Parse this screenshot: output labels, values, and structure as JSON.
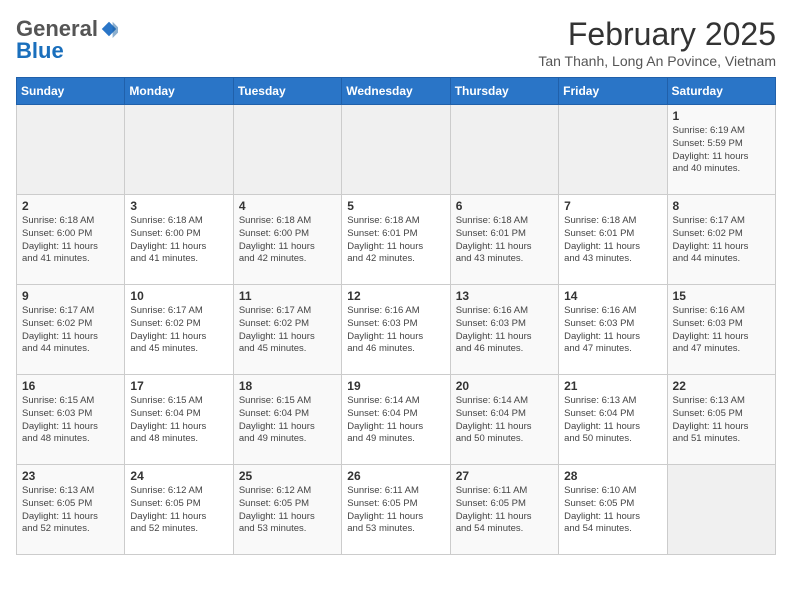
{
  "logo": {
    "general": "General",
    "blue": "Blue"
  },
  "title": "February 2025",
  "subtitle": "Tan Thanh, Long An Povince, Vietnam",
  "days_header": [
    "Sunday",
    "Monday",
    "Tuesday",
    "Wednesday",
    "Thursday",
    "Friday",
    "Saturday"
  ],
  "weeks": [
    [
      {
        "day": "",
        "info": ""
      },
      {
        "day": "",
        "info": ""
      },
      {
        "day": "",
        "info": ""
      },
      {
        "day": "",
        "info": ""
      },
      {
        "day": "",
        "info": ""
      },
      {
        "day": "",
        "info": ""
      },
      {
        "day": "1",
        "info": "Sunrise: 6:19 AM\nSunset: 5:59 PM\nDaylight: 11 hours\nand 40 minutes."
      }
    ],
    [
      {
        "day": "2",
        "info": "Sunrise: 6:18 AM\nSunset: 6:00 PM\nDaylight: 11 hours\nand 41 minutes."
      },
      {
        "day": "3",
        "info": "Sunrise: 6:18 AM\nSunset: 6:00 PM\nDaylight: 11 hours\nand 41 minutes."
      },
      {
        "day": "4",
        "info": "Sunrise: 6:18 AM\nSunset: 6:00 PM\nDaylight: 11 hours\nand 42 minutes."
      },
      {
        "day": "5",
        "info": "Sunrise: 6:18 AM\nSunset: 6:01 PM\nDaylight: 11 hours\nand 42 minutes."
      },
      {
        "day": "6",
        "info": "Sunrise: 6:18 AM\nSunset: 6:01 PM\nDaylight: 11 hours\nand 43 minutes."
      },
      {
        "day": "7",
        "info": "Sunrise: 6:18 AM\nSunset: 6:01 PM\nDaylight: 11 hours\nand 43 minutes."
      },
      {
        "day": "8",
        "info": "Sunrise: 6:17 AM\nSunset: 6:02 PM\nDaylight: 11 hours\nand 44 minutes."
      }
    ],
    [
      {
        "day": "9",
        "info": "Sunrise: 6:17 AM\nSunset: 6:02 PM\nDaylight: 11 hours\nand 44 minutes."
      },
      {
        "day": "10",
        "info": "Sunrise: 6:17 AM\nSunset: 6:02 PM\nDaylight: 11 hours\nand 45 minutes."
      },
      {
        "day": "11",
        "info": "Sunrise: 6:17 AM\nSunset: 6:02 PM\nDaylight: 11 hours\nand 45 minutes."
      },
      {
        "day": "12",
        "info": "Sunrise: 6:16 AM\nSunset: 6:03 PM\nDaylight: 11 hours\nand 46 minutes."
      },
      {
        "day": "13",
        "info": "Sunrise: 6:16 AM\nSunset: 6:03 PM\nDaylight: 11 hours\nand 46 minutes."
      },
      {
        "day": "14",
        "info": "Sunrise: 6:16 AM\nSunset: 6:03 PM\nDaylight: 11 hours\nand 47 minutes."
      },
      {
        "day": "15",
        "info": "Sunrise: 6:16 AM\nSunset: 6:03 PM\nDaylight: 11 hours\nand 47 minutes."
      }
    ],
    [
      {
        "day": "16",
        "info": "Sunrise: 6:15 AM\nSunset: 6:03 PM\nDaylight: 11 hours\nand 48 minutes."
      },
      {
        "day": "17",
        "info": "Sunrise: 6:15 AM\nSunset: 6:04 PM\nDaylight: 11 hours\nand 48 minutes."
      },
      {
        "day": "18",
        "info": "Sunrise: 6:15 AM\nSunset: 6:04 PM\nDaylight: 11 hours\nand 49 minutes."
      },
      {
        "day": "19",
        "info": "Sunrise: 6:14 AM\nSunset: 6:04 PM\nDaylight: 11 hours\nand 49 minutes."
      },
      {
        "day": "20",
        "info": "Sunrise: 6:14 AM\nSunset: 6:04 PM\nDaylight: 11 hours\nand 50 minutes."
      },
      {
        "day": "21",
        "info": "Sunrise: 6:13 AM\nSunset: 6:04 PM\nDaylight: 11 hours\nand 50 minutes."
      },
      {
        "day": "22",
        "info": "Sunrise: 6:13 AM\nSunset: 6:05 PM\nDaylight: 11 hours\nand 51 minutes."
      }
    ],
    [
      {
        "day": "23",
        "info": "Sunrise: 6:13 AM\nSunset: 6:05 PM\nDaylight: 11 hours\nand 52 minutes."
      },
      {
        "day": "24",
        "info": "Sunrise: 6:12 AM\nSunset: 6:05 PM\nDaylight: 11 hours\nand 52 minutes."
      },
      {
        "day": "25",
        "info": "Sunrise: 6:12 AM\nSunset: 6:05 PM\nDaylight: 11 hours\nand 53 minutes."
      },
      {
        "day": "26",
        "info": "Sunrise: 6:11 AM\nSunset: 6:05 PM\nDaylight: 11 hours\nand 53 minutes."
      },
      {
        "day": "27",
        "info": "Sunrise: 6:11 AM\nSunset: 6:05 PM\nDaylight: 11 hours\nand 54 minutes."
      },
      {
        "day": "28",
        "info": "Sunrise: 6:10 AM\nSunset: 6:05 PM\nDaylight: 11 hours\nand 54 minutes."
      },
      {
        "day": "",
        "info": ""
      }
    ]
  ]
}
